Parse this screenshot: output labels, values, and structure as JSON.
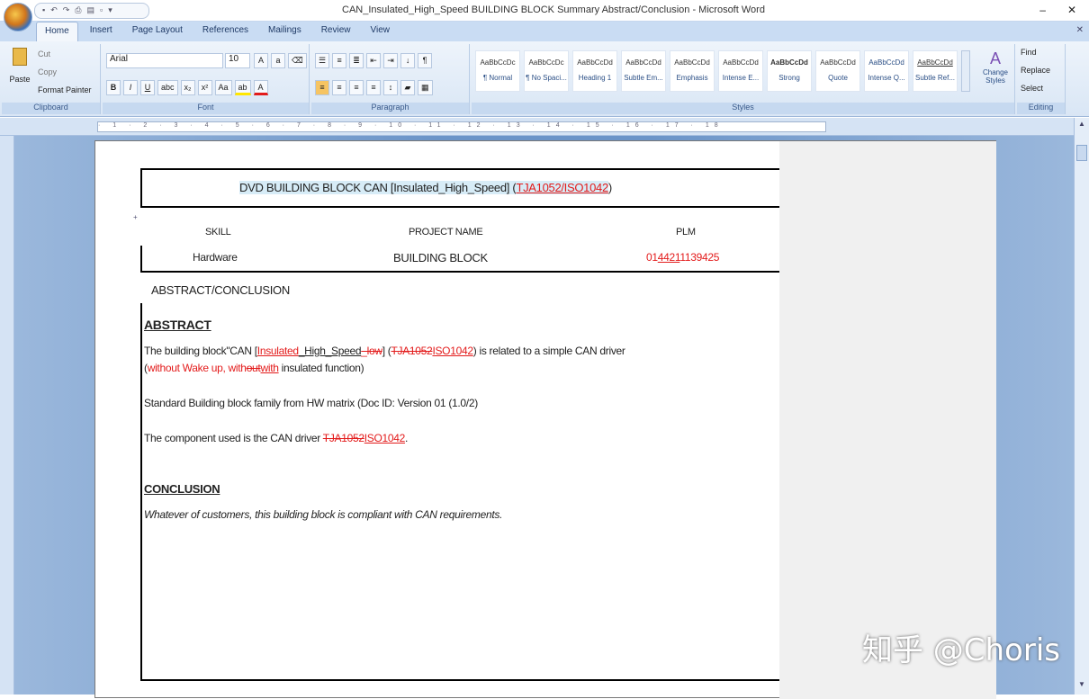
{
  "window": {
    "title": "CAN_Insulated_High_Speed BUILDING BLOCK Summary Abstract/Conclusion - Microsoft Word",
    "quick_access": [
      "save",
      "undo",
      "redo",
      "print",
      "open",
      "new"
    ],
    "controls": [
      "minimize",
      "close"
    ]
  },
  "tabs": [
    "Home",
    "Insert",
    "Page Layout",
    "References",
    "Mailings",
    "Review",
    "View"
  ],
  "ribbon": {
    "clipboard": {
      "label": "Clipboard",
      "paste": "Paste",
      "cut": "Cut",
      "copy": "Copy",
      "format_painter": "Format Painter"
    },
    "font": {
      "label": "Font",
      "font_name": "Arial",
      "font_size": "10"
    },
    "paragraph": {
      "label": "Paragraph"
    },
    "styles": {
      "label": "Styles",
      "items": [
        {
          "preview": "AaBbCcDc",
          "name": "¶ Normal"
        },
        {
          "preview": "AaBbCcDc",
          "name": "¶ No Spaci..."
        },
        {
          "preview": "AaBbCcDd",
          "name": "Heading 1"
        },
        {
          "preview": "AaBbCcDd",
          "name": "Subtle Em..."
        },
        {
          "preview": "AaBbCcDd",
          "name": "Emphasis"
        },
        {
          "preview": "AaBbCcDd",
          "name": "Intense E..."
        },
        {
          "preview": "AaBbCcDd",
          "name": "Strong"
        },
        {
          "preview": "AaBbCcDd",
          "name": "Quote"
        },
        {
          "preview": "AaBbCcDd",
          "name": "Intense Q..."
        },
        {
          "preview": "AaBbCcDd",
          "name": "Subtle Ref..."
        }
      ],
      "change_styles": "Change Styles"
    },
    "editing": {
      "label": "Editing",
      "find": "Find",
      "replace": "Replace",
      "select": "Select"
    }
  },
  "ruler": "· 1 · 2 · 3 · 4 · 5 · 6 · 7 · 8 · 9 · 10 · 11 · 12 · 13 · 14 · 15 · 16 · 17 · 18",
  "document": {
    "header_title_a": "DVD BUILDING BLOCK CAN [Insulated_High_Speed] (",
    "header_title_b": "TJA1052/ISO1042",
    "header_title_c": ")",
    "table_headers": [
      "SKILL",
      "PROJECT NAME",
      "PLM"
    ],
    "table_values": [
      "Hardware",
      "BUILDING BLOCK"
    ],
    "plm_a": "01",
    "plm_b": "4421",
    "plm_c": "1139425",
    "section_heading": "ABSTRACT/CONCLUSION",
    "abstract_heading": "ABSTRACT",
    "abstract_p1_a": "The building block\"CAN [",
    "abstract_p1_b": "Insulated",
    "abstract_p1_c": "_High_Speed",
    "abstract_p1_d": "_low",
    "abstract_p1_e": "] (",
    "abstract_p1_f": "TJA1052",
    "abstract_p1_g": "ISO1042",
    "abstract_p1_h": ") is related to a simple CAN driver",
    "abstract_p2_a": "(",
    "abstract_p2_b": "without Wake up, with",
    "abstract_p2_c": "out",
    "abstract_p2_d": "with",
    "abstract_p2_e": " insulated function)",
    "abstract_p3": "Standard Building block family from HW matrix (Doc ID: Version 01 (1.0/2)",
    "abstract_p4_a": "The component used is the CAN driver ",
    "abstract_p4_b": "TJA1052",
    "abstract_p4_c": "ISO1042",
    "abstract_p4_d": ".",
    "conclusion_heading": "CONCLUSION",
    "conclusion_text": "Whatever of customers, this building block is compliant with CAN requirements."
  },
  "watermark": "知乎 @Choris"
}
